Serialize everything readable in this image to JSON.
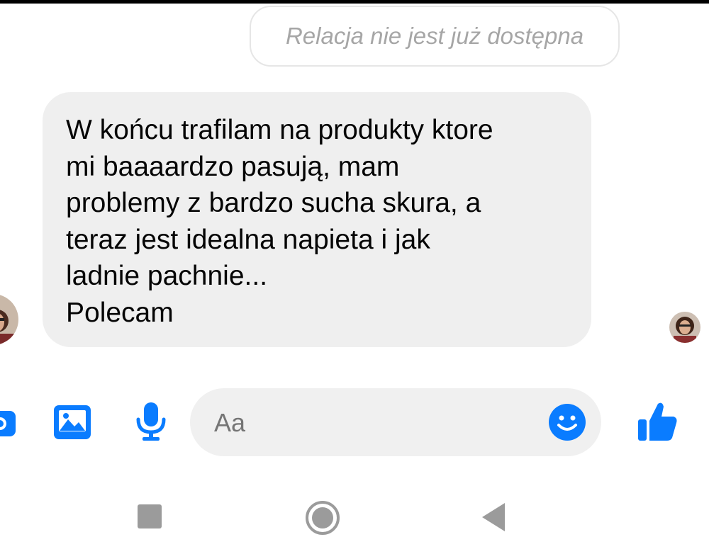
{
  "story_notice": {
    "text": "Relacja nie jest już dostępna"
  },
  "message": {
    "lines": [
      "W końcu trafilam na produkty ktore",
      "mi baaaardzo pasują, mam",
      "problemy z bardzo sucha skura, a",
      "teraz jest idealna napieta i jak",
      "ladnie pachnie...",
      "Polecam"
    ]
  },
  "composer": {
    "placeholder": "Aa",
    "icons": [
      "camera-icon",
      "image-icon",
      "microphone-icon",
      "emoji-icon",
      "thumbs-up-icon"
    ]
  },
  "nav": {
    "icons": [
      "recent-apps-icon",
      "home-icon",
      "back-icon"
    ]
  },
  "colors": {
    "accent": "#0a7cff",
    "bubble": "#efefef",
    "input": "#f0f0f0",
    "nav": "#9b9b9b"
  }
}
